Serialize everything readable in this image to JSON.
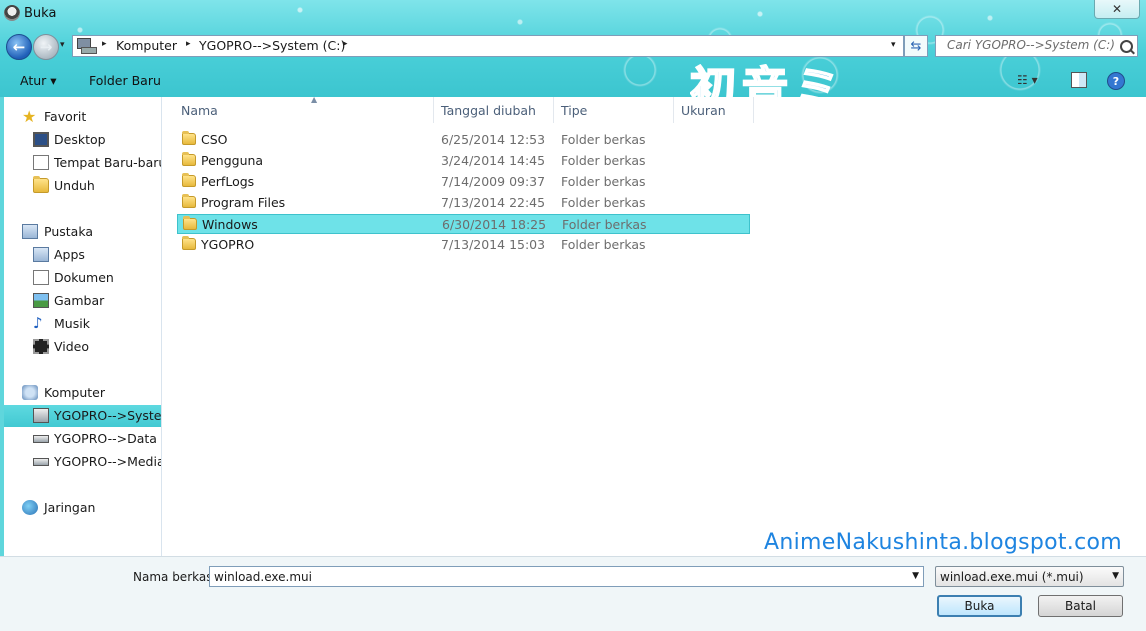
{
  "window": {
    "title": "Buka",
    "close_glyph": "✕"
  },
  "nav": {
    "back_glyph": "←",
    "forward_glyph": "→",
    "dropdown_glyph": "▾",
    "refresh_glyph": "⇆"
  },
  "address": {
    "crumbs": [
      "Komputer",
      "YGOPRO-->System (C:)"
    ],
    "separator": "▸",
    "dropdown_glyph": "▾"
  },
  "search": {
    "placeholder": "Cari YGOPRO-->System (C:)"
  },
  "toolbar": {
    "organize": "Atur ▾",
    "new_folder": "Folder Baru",
    "views_glyph": "☷ ▾",
    "help_glyph": "?"
  },
  "banner_text": "初音ミク",
  "sidebar": {
    "favorites": {
      "label": "Favorit",
      "items": [
        "Desktop",
        "Tempat Baru-baru ini",
        "Unduh"
      ]
    },
    "libraries": {
      "label": "Pustaka",
      "items": [
        "Apps",
        "Dokumen",
        "Gambar",
        "Musik",
        "Video"
      ]
    },
    "computer": {
      "label": "Komputer",
      "items": [
        "YGOPRO-->System (C:)",
        "YGOPRO-->Data (D:)",
        "YGOPRO-->Media (E:)"
      ],
      "selected": 0
    },
    "network": {
      "label": "Jaringan"
    }
  },
  "columns": [
    "Nama",
    "Tanggal diubah",
    "Tipe",
    "Ukuran"
  ],
  "files": [
    {
      "name": "CSO",
      "date": "6/25/2014 12:53",
      "type": "Folder berkas"
    },
    {
      "name": "Pengguna",
      "date": "3/24/2014 14:45",
      "type": "Folder berkas"
    },
    {
      "name": "PerfLogs",
      "date": "7/14/2009 09:37",
      "type": "Folder berkas"
    },
    {
      "name": "Program Files",
      "date": "7/13/2014 22:45",
      "type": "Folder berkas"
    },
    {
      "name": "Windows",
      "date": "6/30/2014 18:25",
      "type": "Folder berkas"
    },
    {
      "name": "YGOPRO",
      "date": "7/13/2014 15:03",
      "type": "Folder berkas"
    }
  ],
  "selected_file": 4,
  "watermark": "AnimeNakushinta.blogspot.com",
  "bottom": {
    "filename_label": "Nama berkas:",
    "filename_value": "winload.exe.mui",
    "filetype_value": "winload.exe.mui (*.mui)",
    "open_label": "Buka",
    "cancel_label": "Batal"
  },
  "colors": {
    "accent": "#42c9d2",
    "selection": "#6ee2e8",
    "watermark": "#1e84e0"
  }
}
